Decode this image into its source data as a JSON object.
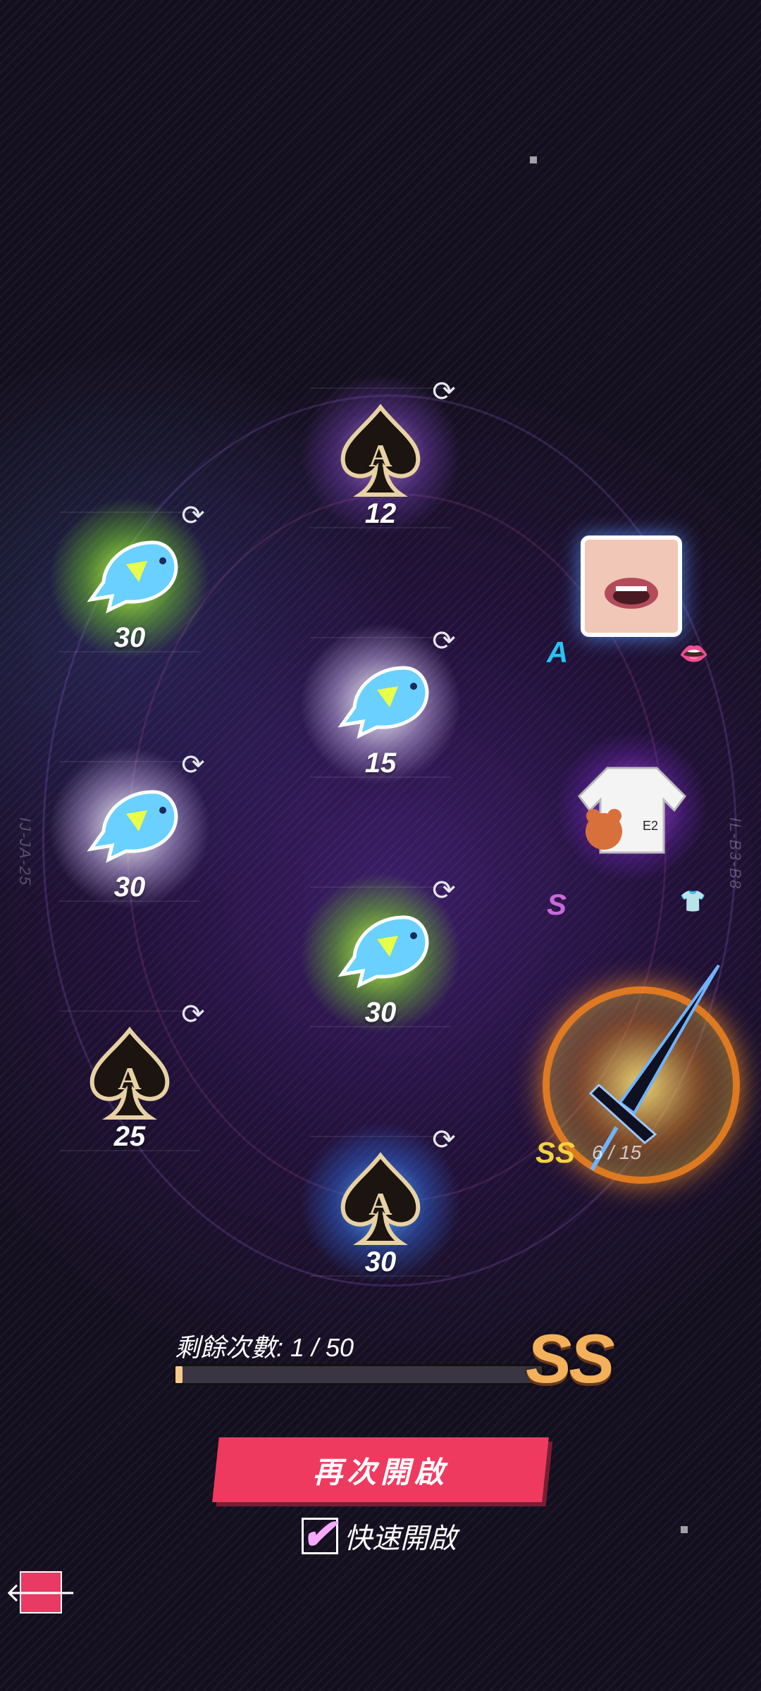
{
  "grid": {
    "tiles": [
      {
        "id": "t1",
        "item": "spade-card",
        "count": "12",
        "glow": "purple"
      },
      {
        "id": "t2",
        "item": "fish",
        "count": "30",
        "glow": "green"
      },
      {
        "id": "t3",
        "item": "fish",
        "count": "15",
        "glow": "white"
      },
      {
        "id": "t4",
        "item": "fish",
        "count": "30",
        "glow": "white"
      },
      {
        "id": "t5",
        "item": "fish",
        "count": "30",
        "glow": "green"
      },
      {
        "id": "t6",
        "item": "spade-card",
        "count": "25",
        "glow": "none"
      },
      {
        "id": "t7",
        "item": "spade-card",
        "count": "30",
        "glow": "blue"
      }
    ],
    "rare": [
      {
        "grade": "A",
        "item": "mouth-avatar",
        "icon": "lips-icon",
        "grade_color": "#26c4f0"
      },
      {
        "grade": "S",
        "item": "hoodie-teddy-outfit",
        "icon": "shirt-icon",
        "grade_color": "#c86ad8"
      },
      {
        "grade": "SS",
        "item": "sword",
        "icon": "sword-icon",
        "grade_color": "#f2d240",
        "progress": "6 / 15"
      }
    ]
  },
  "side_labels": {
    "left": "IJ-JA-25",
    "right": "IL-B3-B8"
  },
  "remaining": {
    "label": "剩餘次數: 1 / 50",
    "fraction": 0.02,
    "grade": "SS"
  },
  "actions": {
    "open_again": "再次開啟",
    "quick_open": "快速開啟",
    "quick_open_checked": true
  },
  "colors": {
    "accent": "#ef3a60",
    "grade_ss": "#f3b15c"
  }
}
